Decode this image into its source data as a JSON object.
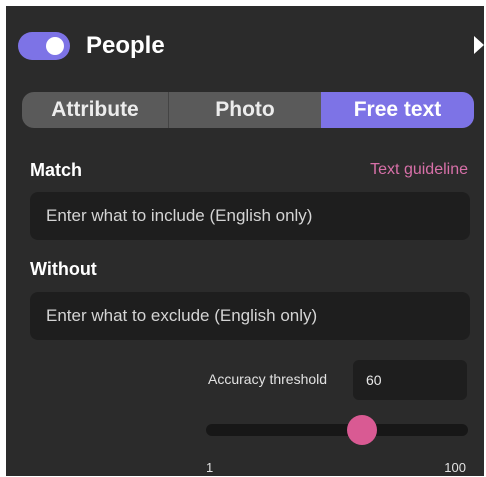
{
  "header": {
    "title": "People",
    "toggle_on": true
  },
  "tabs": [
    {
      "label": "Attribute",
      "active": false
    },
    {
      "label": "Photo",
      "active": false
    },
    {
      "label": "Free text",
      "active": true
    }
  ],
  "match": {
    "label": "Match",
    "guideline_link": "Text guideline",
    "placeholder": "Enter what to include (English only)"
  },
  "without": {
    "label": "Without",
    "placeholder": "Enter what to exclude (English only)"
  },
  "accuracy": {
    "label": "Accuracy threshold",
    "value": "60",
    "min_label": "1",
    "max_label": "100",
    "min": 1,
    "max": 100,
    "slider_value": 60
  },
  "colors": {
    "accent": "#7d73e6",
    "slider_thumb": "#d95a93",
    "link": "#d770a8",
    "panel_bg": "#2b2b2b"
  }
}
